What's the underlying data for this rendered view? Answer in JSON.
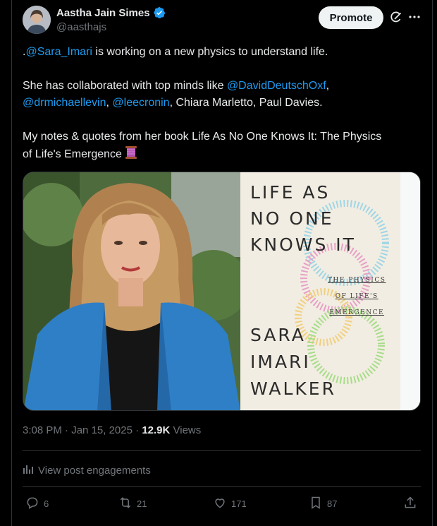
{
  "author": {
    "name": "Aastha Jain Simes",
    "handle": "@aasthajs",
    "verified_color": "#1d9bf0"
  },
  "header": {
    "promote_label": "Promote",
    "grok_icon": "grok-icon",
    "more_icon": "more-icon"
  },
  "tweet": {
    "line1_prefix": ".",
    "line1_mention": "@Sara_Imari",
    "line1_rest": " is working on a new physics to understand life.",
    "line2_prefix": "She has collaborated with top minds like ",
    "line2_mention1": "@DavidDeutschOxf",
    "line2_comma1": ",",
    "line3_mention2": "@drmichaellevin",
    "line3_sep": ", ",
    "line3_mention3": "@leecronin",
    "line3_rest": ", Chiara Marletto, Paul Davies.",
    "line4": "My notes & quotes from her book Life As No One Knows It: The Physics",
    "line5": "of Life's Emergence",
    "emoji_icon": "thread-spool-icon"
  },
  "media": {
    "cover_title": "LIFE AS\nNO ONE\nKNOWS IT",
    "cover_subtitle": "THE PHYSICS\nOF LIFE'S\nEMERGENCE",
    "cover_author": "SARA\nIMARI\nWALKER"
  },
  "meta": {
    "time": "3:08 PM",
    "dot": " · ",
    "date": "Jan 15, 2025",
    "views_count": "12.9K",
    "views_label": " Views"
  },
  "engagements_label": "View post engagements",
  "actions": {
    "replies": "6",
    "reposts": "21",
    "likes": "171",
    "bookmarks": "87"
  },
  "colors": {
    "background": "#000000",
    "text": "#e7e9ea",
    "muted": "#71767b",
    "link": "#1d9bf0",
    "border": "#2f3336"
  }
}
